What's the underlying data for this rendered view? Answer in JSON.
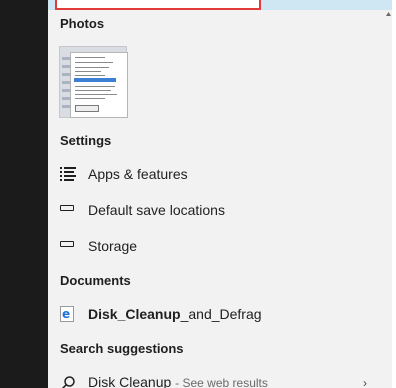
{
  "sections": {
    "photos": "Photos",
    "settings": "Settings",
    "documents": "Documents",
    "search_suggestions": "Search suggestions"
  },
  "settings_items": [
    {
      "label": "Apps & features",
      "icon": "apps-list-icon"
    },
    {
      "label": "Default save locations",
      "icon": "drive-icon"
    },
    {
      "label": "Storage",
      "icon": "drive-icon"
    }
  ],
  "document": {
    "bold_part": "Disk_Cleanup",
    "rest": "_and_Defrag",
    "icon": "internet-explorer-icon"
  },
  "suggestion": {
    "query": "Disk Cleanup",
    "hint": "See web results",
    "icon": "search-icon"
  },
  "colors": {
    "panel_bg": "#f2f2f2",
    "highlight_border": "#e23b3b",
    "top_bar": "#cfe6f3"
  }
}
